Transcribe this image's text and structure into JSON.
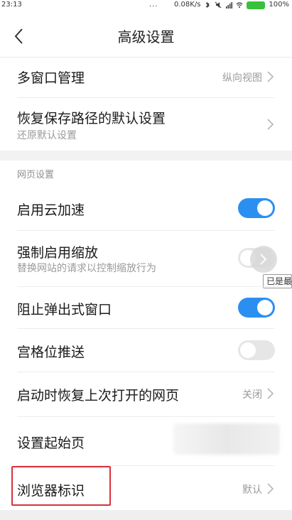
{
  "status_bar": {
    "time": "23:13",
    "dots": "...",
    "network_speed": "0.08K/s",
    "battery": "100%"
  },
  "header": {
    "title": "高级设置"
  },
  "rows": {
    "multi_window": {
      "title": "多窗口管理",
      "value": "纵向视图"
    },
    "restore_path": {
      "title": "恢复保存路径的默认设置",
      "subtitle": "还原默认设置"
    }
  },
  "section": {
    "label": "网页设置"
  },
  "settings": {
    "cloud_accel": {
      "title": "启用云加速",
      "enabled": true
    },
    "force_zoom": {
      "title": "强制启用缩放",
      "subtitle": "替换网站的请求以控制缩放行为",
      "enabled": false
    },
    "block_popups": {
      "title": "阻止弹出式窗口",
      "enabled": true
    },
    "grid_push": {
      "title": "宫格位推送",
      "enabled": false
    },
    "restore_last": {
      "title": "启动时恢复上次打开的网页",
      "value": "关闭"
    },
    "start_page": {
      "title": "设置起始页"
    },
    "browser_ua": {
      "title": "浏览器标识",
      "value": "默认"
    }
  },
  "tooltip": {
    "text": "已是最"
  },
  "colors": {
    "toggle_on": "#2b8ff2",
    "toggle_off": "#e6e6e6",
    "highlight": "#d9303a"
  }
}
